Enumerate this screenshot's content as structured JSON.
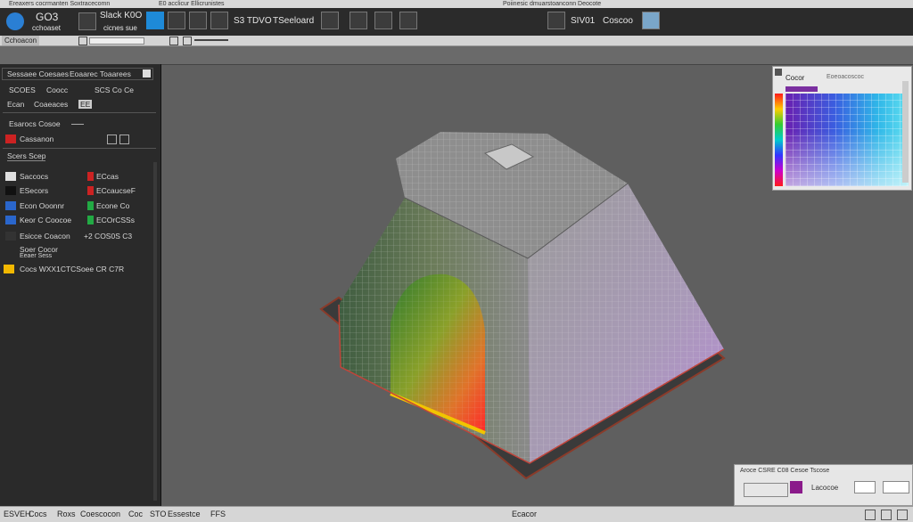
{
  "topbar": {
    "left_title": "Ereaxers cocrmanten Soxtracecomn",
    "mid_title": "E0 acclicur Ellicrunistes",
    "right_title": "Poiinesic dmuarstoanconn Deocote"
  },
  "toolbar": {
    "file_label": "GO3",
    "file_sub": "cchoaset",
    "slack_label": "Slack K0O",
    "slack_sub": "cicnes sue",
    "mode_label": "S3 TDVO",
    "mode_sub": "TSeeloard",
    "view_label": "SIV01",
    "view_sub": "Coscoo"
  },
  "ribbon": {
    "left_label": "Cchoacon"
  },
  "left_panel": {
    "header_1": "Sessaee Coesaes",
    "header_1b": "Eoaarec Toaarees",
    "row_2a": "SCOES",
    "row_2b": "Coocc",
    "row_2c": "SCS Co Ce",
    "row_3a": "Ecan",
    "row_3b": "Coaeaces",
    "row_3c": "EE",
    "row_4": "Esarocs Cosoe",
    "row_5": "Cassanon",
    "section": "Scers Scep",
    "items": [
      {
        "label": "Saccocs",
        "right": "ECcas",
        "color": "#e0e0e0",
        "rcolor": "#cc2222"
      },
      {
        "label": "ESecors",
        "right": "ECcaucseF",
        "color": "#111111",
        "rcolor": "#cc2222"
      },
      {
        "label": "Econ Ooonnr",
        "right": "Econe Co",
        "color": "#2a66cc",
        "rcolor": "#22aa44"
      },
      {
        "label": "Keor C Coocoe",
        "right": "ECOrCSSs",
        "color": "#2a66cc",
        "rcolor": "#22aa44"
      },
      {
        "label": "Esicce Coacon",
        "right": "+2 COS0S C3",
        "color": "#333333",
        "rcolor": "#555555"
      }
    ],
    "extra_1": "Soer Cocor",
    "extra_2": "Eeaer Sess",
    "footer": "Cocs WXX1CTCSoee CR C7R"
  },
  "color_panel": {
    "title": "Cocor",
    "subtitle": "Eoeoacoscoc"
  },
  "bottom_right": {
    "title": "Aroce CSRE C08 Cesoe Tscose",
    "label": "Lacocoe"
  },
  "status": {
    "s1": "ESVEH",
    "s2": "Cocs",
    "s3": "Roxs",
    "s4": "Coescocon",
    "s5": "Coc",
    "s6": "STO",
    "s7": "Essestce",
    "s8": "FFS",
    "center": "Ecacor"
  },
  "colors": {
    "accent_blue": "#2a7fd4",
    "panel_dark": "#2a2a2a",
    "viewport_bg": "#5f5f5f"
  }
}
